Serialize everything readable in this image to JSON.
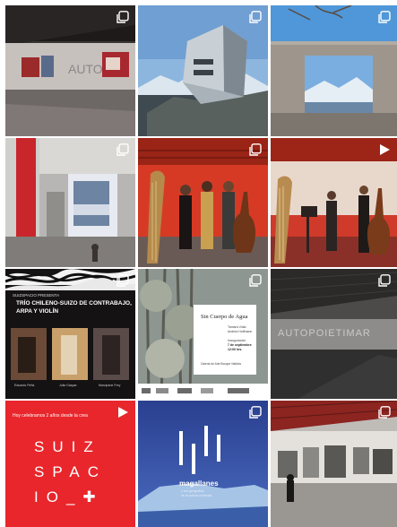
{
  "grid": {
    "tiles": [
      {
        "id": "gallery-hall-red-ceiling",
        "badge": "multi-image-icon",
        "wall_text": "AUTO"
      },
      {
        "id": "mountain-hut-building",
        "badge": "multi-image-icon"
      },
      {
        "id": "stone-window-lake",
        "badge": "multi-image-icon"
      },
      {
        "id": "interior-atrium-banner",
        "badge": "multi-image-icon"
      },
      {
        "id": "harp-trio-red",
        "badge": "multi-image-icon"
      },
      {
        "id": "music-performance-video",
        "badge": "play-icon"
      },
      {
        "id": "trio-concert-poster",
        "badge": "multi-image-icon",
        "presenter": "SUIZSPACIO PRESENTA",
        "title_line1": "TRÍO CHILENO-SUIZO DE CONTRABAJO,",
        "title_line2": "ARPA Y VIOLÍN",
        "captions": [
          "Eduardo Peña",
          "Julia Gaspar",
          "Marzipane Frey"
        ]
      },
      {
        "id": "sin-cuerpo-de-agua-poster",
        "badge": "multi-image-icon",
        "title": "Sin Cuerpo de Agua",
        "lines": [
          "Tamara Vidal",
          "Andrea Hoffmann",
          "Inauguración",
          "7 de septiembre",
          "12:00 hrs.",
          "Galería de Arte Bosque Valdivia"
        ]
      },
      {
        "id": "autopoietimar-gallery",
        "badge": "multi-image-icon",
        "wall_text": "AUTOPOIETIMAR"
      },
      {
        "id": "suizspacio-anniversary-video",
        "badge": "play-icon",
        "tagline": "Hoy celebramos 2 años desde la crea",
        "logo_lines": [
          "SUIZ",
          "SPAC",
          "IO_✚"
        ]
      },
      {
        "id": "magallanes-iceberg",
        "badge": "multi-image-icon",
        "brand": "magallanes",
        "subtitle": "y sus geografías",
        "subtitle2": "de la cultura universal"
      },
      {
        "id": "photo-gallery-visitor",
        "badge": "multi-image-icon"
      }
    ]
  },
  "colors": {
    "brand_red": "#e8262b",
    "deep_red": "#c81c22",
    "icon_white": "#ffffff"
  }
}
